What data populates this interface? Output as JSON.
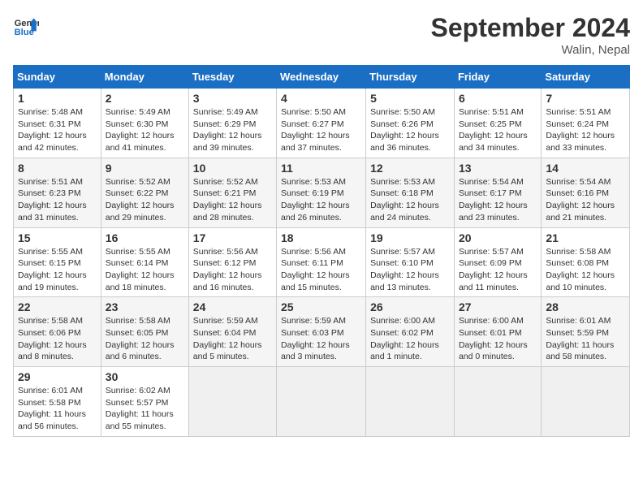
{
  "logo": {
    "line1": "General",
    "line2": "Blue"
  },
  "title": "September 2024",
  "location": "Walin, Nepal",
  "weekdays": [
    "Sunday",
    "Monday",
    "Tuesday",
    "Wednesday",
    "Thursday",
    "Friday",
    "Saturday"
  ],
  "weeks": [
    [
      {
        "day": "1",
        "sunrise": "5:48 AM",
        "sunset": "6:31 PM",
        "daylight": "12 hours and 42 minutes."
      },
      {
        "day": "2",
        "sunrise": "5:49 AM",
        "sunset": "6:30 PM",
        "daylight": "12 hours and 41 minutes."
      },
      {
        "day": "3",
        "sunrise": "5:49 AM",
        "sunset": "6:29 PM",
        "daylight": "12 hours and 39 minutes."
      },
      {
        "day": "4",
        "sunrise": "5:50 AM",
        "sunset": "6:27 PM",
        "daylight": "12 hours and 37 minutes."
      },
      {
        "day": "5",
        "sunrise": "5:50 AM",
        "sunset": "6:26 PM",
        "daylight": "12 hours and 36 minutes."
      },
      {
        "day": "6",
        "sunrise": "5:51 AM",
        "sunset": "6:25 PM",
        "daylight": "12 hours and 34 minutes."
      },
      {
        "day": "7",
        "sunrise": "5:51 AM",
        "sunset": "6:24 PM",
        "daylight": "12 hours and 33 minutes."
      }
    ],
    [
      {
        "day": "8",
        "sunrise": "5:51 AM",
        "sunset": "6:23 PM",
        "daylight": "12 hours and 31 minutes."
      },
      {
        "day": "9",
        "sunrise": "5:52 AM",
        "sunset": "6:22 PM",
        "daylight": "12 hours and 29 minutes."
      },
      {
        "day": "10",
        "sunrise": "5:52 AM",
        "sunset": "6:21 PM",
        "daylight": "12 hours and 28 minutes."
      },
      {
        "day": "11",
        "sunrise": "5:53 AM",
        "sunset": "6:19 PM",
        "daylight": "12 hours and 26 minutes."
      },
      {
        "day": "12",
        "sunrise": "5:53 AM",
        "sunset": "6:18 PM",
        "daylight": "12 hours and 24 minutes."
      },
      {
        "day": "13",
        "sunrise": "5:54 AM",
        "sunset": "6:17 PM",
        "daylight": "12 hours and 23 minutes."
      },
      {
        "day": "14",
        "sunrise": "5:54 AM",
        "sunset": "6:16 PM",
        "daylight": "12 hours and 21 minutes."
      }
    ],
    [
      {
        "day": "15",
        "sunrise": "5:55 AM",
        "sunset": "6:15 PM",
        "daylight": "12 hours and 19 minutes."
      },
      {
        "day": "16",
        "sunrise": "5:55 AM",
        "sunset": "6:14 PM",
        "daylight": "12 hours and 18 minutes."
      },
      {
        "day": "17",
        "sunrise": "5:56 AM",
        "sunset": "6:12 PM",
        "daylight": "12 hours and 16 minutes."
      },
      {
        "day": "18",
        "sunrise": "5:56 AM",
        "sunset": "6:11 PM",
        "daylight": "12 hours and 15 minutes."
      },
      {
        "day": "19",
        "sunrise": "5:57 AM",
        "sunset": "6:10 PM",
        "daylight": "12 hours and 13 minutes."
      },
      {
        "day": "20",
        "sunrise": "5:57 AM",
        "sunset": "6:09 PM",
        "daylight": "12 hours and 11 minutes."
      },
      {
        "day": "21",
        "sunrise": "5:58 AM",
        "sunset": "6:08 PM",
        "daylight": "12 hours and 10 minutes."
      }
    ],
    [
      {
        "day": "22",
        "sunrise": "5:58 AM",
        "sunset": "6:06 PM",
        "daylight": "12 hours and 8 minutes."
      },
      {
        "day": "23",
        "sunrise": "5:58 AM",
        "sunset": "6:05 PM",
        "daylight": "12 hours and 6 minutes."
      },
      {
        "day": "24",
        "sunrise": "5:59 AM",
        "sunset": "6:04 PM",
        "daylight": "12 hours and 5 minutes."
      },
      {
        "day": "25",
        "sunrise": "5:59 AM",
        "sunset": "6:03 PM",
        "daylight": "12 hours and 3 minutes."
      },
      {
        "day": "26",
        "sunrise": "6:00 AM",
        "sunset": "6:02 PM",
        "daylight": "12 hours and 1 minute."
      },
      {
        "day": "27",
        "sunrise": "6:00 AM",
        "sunset": "6:01 PM",
        "daylight": "12 hours and 0 minutes."
      },
      {
        "day": "28",
        "sunrise": "6:01 AM",
        "sunset": "5:59 PM",
        "daylight": "11 hours and 58 minutes."
      }
    ],
    [
      {
        "day": "29",
        "sunrise": "6:01 AM",
        "sunset": "5:58 PM",
        "daylight": "11 hours and 56 minutes."
      },
      {
        "day": "30",
        "sunrise": "6:02 AM",
        "sunset": "5:57 PM",
        "daylight": "11 hours and 55 minutes."
      },
      null,
      null,
      null,
      null,
      null
    ]
  ]
}
